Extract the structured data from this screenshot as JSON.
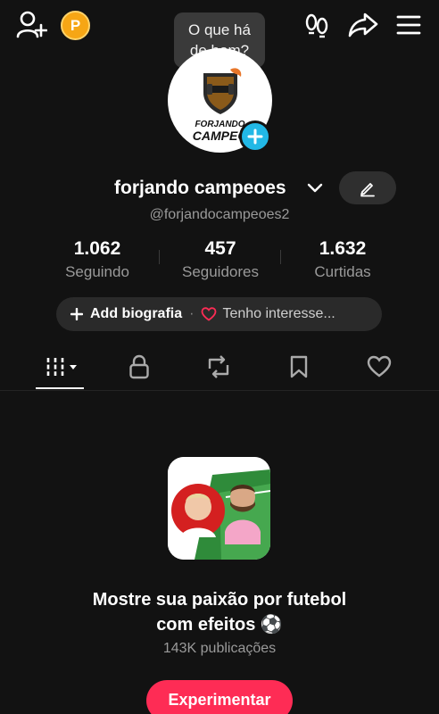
{
  "topbar": {
    "add_friend_icon": "person-add-icon",
    "coin_letter": "P",
    "tooltip_line1": "O que há",
    "tooltip_line2": "de bom?",
    "footprints_icon": "footprints-icon",
    "share_icon": "share-icon",
    "menu_icon": "hamburger-menu-icon"
  },
  "profile": {
    "avatar_text_line1": "FORJANDO",
    "avatar_text_line2": "CAMPEÕ",
    "name": "forjando campeoes",
    "handle": "@forjandocampeoes2",
    "edit_icon": "pencil-icon"
  },
  "stats": [
    {
      "value": "1.062",
      "label": "Seguindo"
    },
    {
      "value": "457",
      "label": "Seguidores"
    },
    {
      "value": "1.632",
      "label": "Curtidas"
    }
  ],
  "bio": {
    "plus": "+",
    "add_label": "Add biografia",
    "separator": "·",
    "interest_label": "Tenho interesse..."
  },
  "tabs": [
    {
      "icon": "grid-icon",
      "active": true
    },
    {
      "icon": "lock-icon",
      "active": false
    },
    {
      "icon": "repost-icon",
      "active": false
    },
    {
      "icon": "bookmark-icon",
      "active": false
    },
    {
      "icon": "heart-icon",
      "active": false
    }
  ],
  "promo": {
    "title_line1": "Mostre sua paixão por futebol",
    "title_line2": "com efeitos ⚽",
    "subtitle": "143K publicações",
    "button_label": "Experimentar"
  },
  "colors": {
    "background": "#121212",
    "accent": "#fe2c55",
    "badge_blue": "#22b8e6",
    "coin": "#f6a615"
  }
}
